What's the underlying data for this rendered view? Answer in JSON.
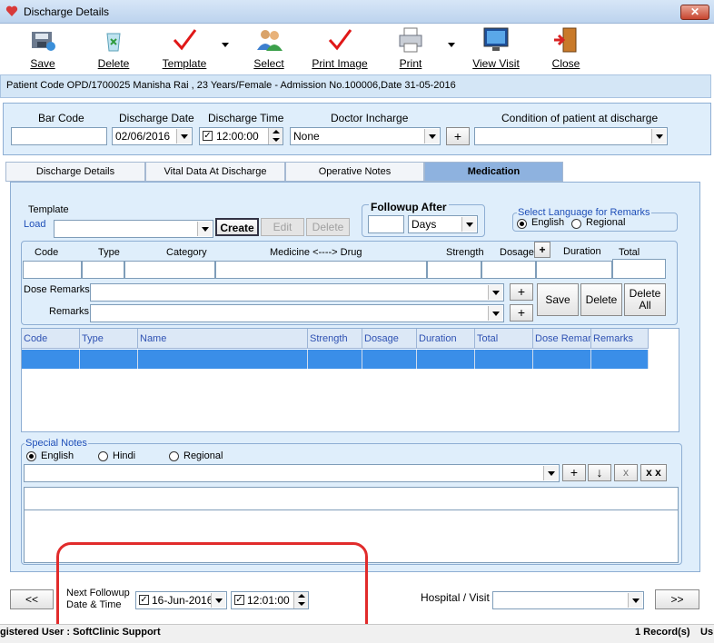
{
  "window": {
    "title": "Discharge Details"
  },
  "toolbar": {
    "save": "Save",
    "delete": "Delete",
    "template": "Template",
    "select": "Select",
    "print_image": "Print Image",
    "print": "Print",
    "view_visit": "View Visit",
    "close": "Close"
  },
  "patient_info": "Patient Code OPD/1700025 Manisha Rai , 23 Years/Female - Admission No.100006,Date 31-05-2016",
  "top": {
    "bar_code_label": "Bar Code",
    "bar_code_value": "",
    "discharge_date_label": "Discharge Date",
    "discharge_date_value": "02/06/2016",
    "discharge_time_label": "Discharge Time",
    "discharge_time_value": "12:00:00",
    "discharge_time_check": "✓",
    "doctor_label": "Doctor Incharge",
    "doctor_value": "None",
    "doctor_add": "+",
    "condition_label": "Condition of patient at discharge",
    "condition_value": ""
  },
  "tabs": [
    {
      "label": "Discharge Details"
    },
    {
      "label": "Vital Data At Discharge"
    },
    {
      "label": "Operative Notes"
    },
    {
      "label": "Medication"
    }
  ],
  "medication": {
    "template_label": "Template",
    "load_label": "Load",
    "template_value": "",
    "create": "Create",
    "edit": "Edit",
    "delete": "Delete",
    "followup_label": "Followup After",
    "followup_value": "",
    "followup_unit": "Days",
    "language_label": "Select Language for Remarks",
    "english": "English",
    "regional": "Regional",
    "entry_headers": {
      "code": "Code",
      "type": "Type",
      "category": "Category",
      "drug": "Medicine <----> Drug",
      "strength": "Strength",
      "dosage": "Dosage",
      "duration": "Duration",
      "total": "Total"
    },
    "dosage_add": "+",
    "dose_remarks_label": "Dose Remarks",
    "remarks_label": "Remarks",
    "save": "Save",
    "delete_btn": "Delete",
    "delete_all": "Delete All",
    "add": "+",
    "grid_headers": [
      "Code",
      "Type",
      "Name",
      "Strength",
      "Dosage",
      "Duration",
      "Total",
      "Dose Remar",
      "Remarks"
    ]
  },
  "special_notes": {
    "label": "Special Notes",
    "english": "English",
    "hindi": "Hindi",
    "regional": "Regional",
    "add": "+",
    "down": "↓",
    "x": "x",
    "xx": "x x"
  },
  "footer": {
    "prev": "<<",
    "next": ">>",
    "next_followup_label_1": "Next Followup",
    "next_followup_label_2": "Date & Time",
    "followup_date": "16-Jun-2016",
    "followup_time": "12:01:00",
    "check": "✓",
    "hospital_visit_label": "Hospital / Visit",
    "hospital_visit_value": ""
  },
  "status": {
    "user": "gistered User : SoftClinic Support",
    "records": "1 Record(s)",
    "extra": "Us"
  }
}
